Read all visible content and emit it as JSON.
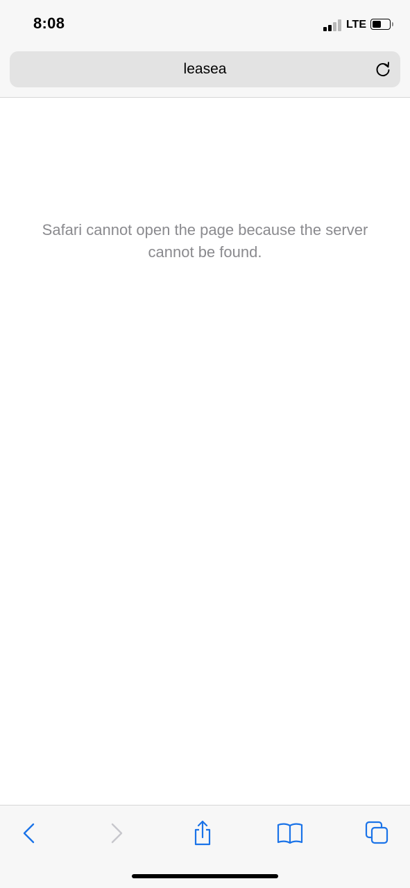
{
  "status_bar": {
    "time": "8:08",
    "network": "LTE",
    "signal_bars_active": 2,
    "signal_bars_total": 4,
    "battery_level": 0.5
  },
  "address_bar": {
    "text": "leasea",
    "reload_icon": "reload-icon"
  },
  "page": {
    "error_message": "Safari cannot open the page because the server cannot be found."
  },
  "toolbar": {
    "items": [
      "back-icon",
      "forward-icon",
      "share-icon",
      "bookmarks-icon",
      "tabs-icon"
    ]
  },
  "colors": {
    "accent": "#1a73e8",
    "disabled": "#c7c7cc",
    "message_text": "#8a8a8e",
    "chrome_background": "#f7f7f7",
    "address_bar_background": "#e3e3e3"
  }
}
